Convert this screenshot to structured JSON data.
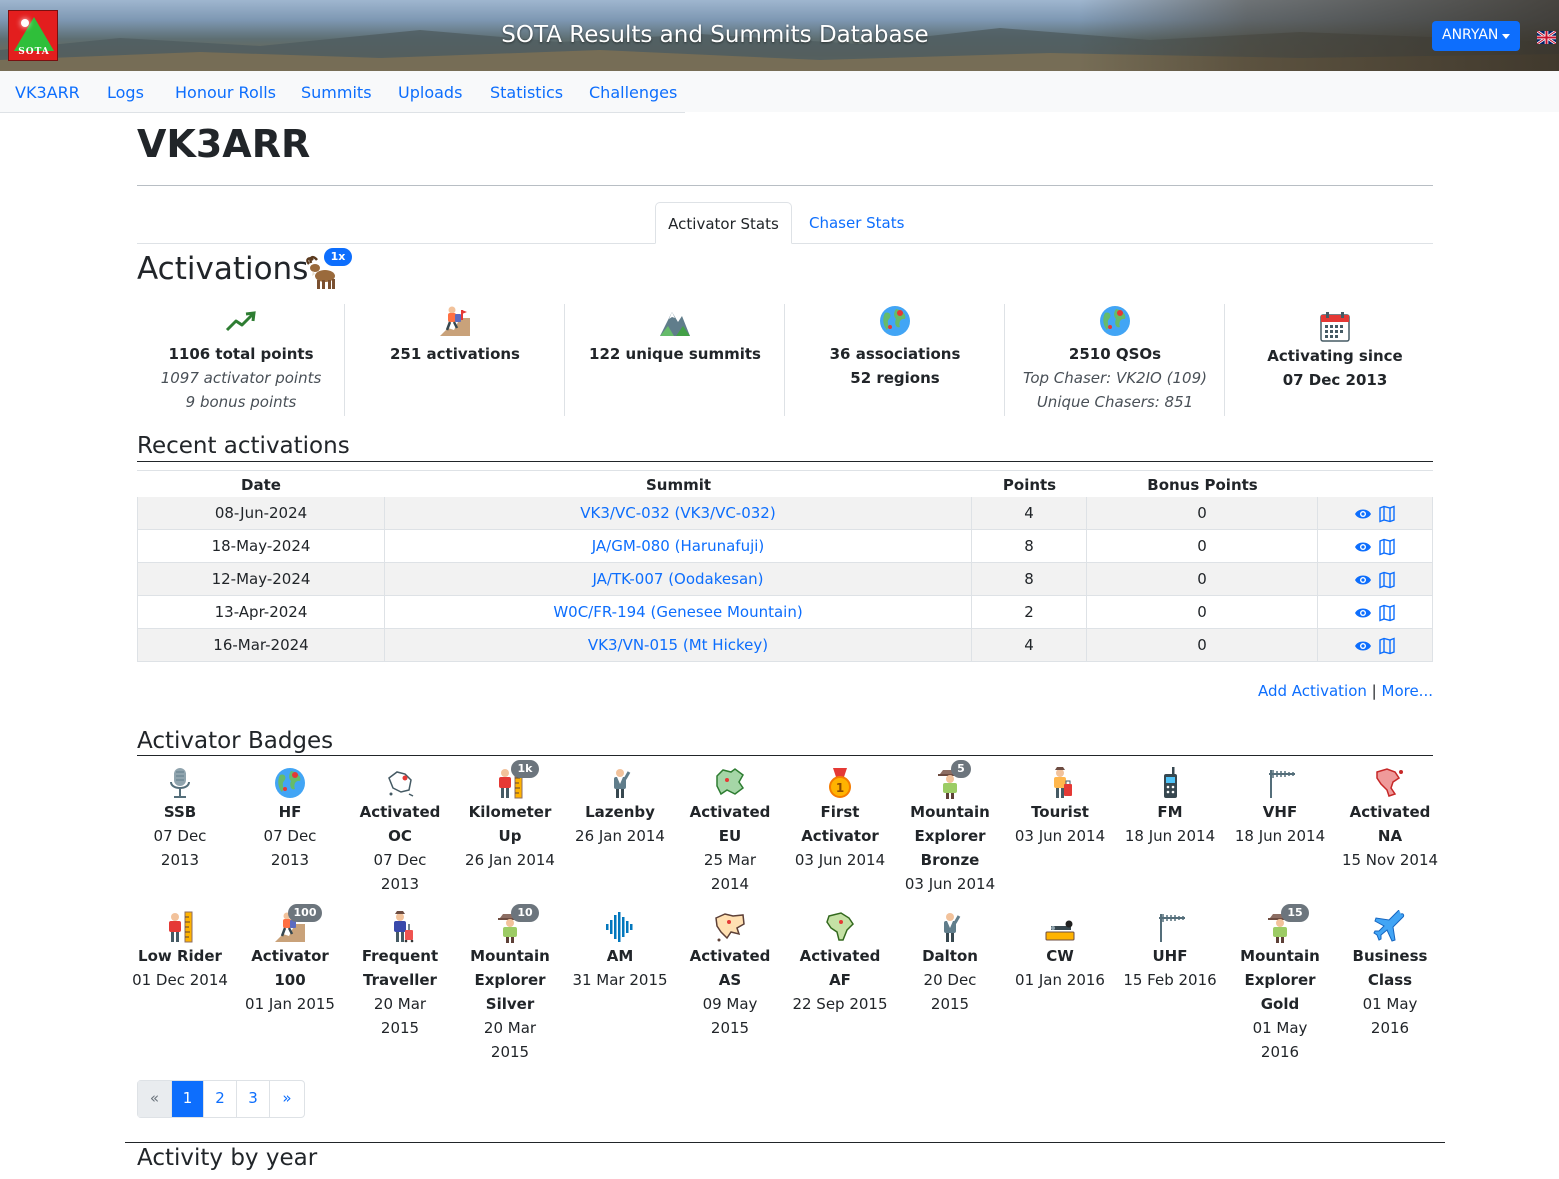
{
  "header": {
    "site_title": "SOTA Results and Summits Database",
    "logo_text": "SOTA",
    "user_button": "ANRYAN"
  },
  "nav": [
    "VK3ARR",
    "Logs",
    "Honour Rolls",
    "Summits",
    "Uploads",
    "Statistics",
    "Challenges"
  ],
  "page_title": "VK3ARR",
  "tabs": {
    "active": "Activator Stats",
    "other": "Chaser Stats"
  },
  "activations": {
    "heading": "Activations",
    "goat_badge": "1x",
    "stats": [
      {
        "icon": "trending-up-icon",
        "lines": [
          "1106 total points"
        ],
        "italics": [
          "1097 activator points",
          "9 bonus points"
        ]
      },
      {
        "icon": "climber-icon",
        "lines": [
          "251 activations"
        ],
        "italics": []
      },
      {
        "icon": "mountain-icon",
        "lines": [
          "122 unique summits"
        ],
        "italics": []
      },
      {
        "icon": "globe-icon",
        "lines": [
          "36 associations",
          "52 regions"
        ],
        "italics": []
      },
      {
        "icon": "globe-icon",
        "lines": [
          "2510 QSOs"
        ],
        "italics": [
          "Top Chaser: VK2IO (109)",
          "Unique Chasers: 851"
        ]
      },
      {
        "icon": "calendar-icon",
        "lines": [
          "Activating since",
          "07 Dec 2013"
        ],
        "italics": []
      }
    ]
  },
  "recent": {
    "heading": "Recent activations",
    "columns": [
      "Date",
      "Summit",
      "Points",
      "Bonus Points"
    ],
    "rows": [
      {
        "date": "08-Jun-2024",
        "summit": "VK3/VC-032 (VK3/VC-032)",
        "points": "4",
        "bonus": "0"
      },
      {
        "date": "18-May-2024",
        "summit": "JA/GM-080 (Harunafuji)",
        "points": "8",
        "bonus": "0"
      },
      {
        "date": "12-May-2024",
        "summit": "JA/TK-007 (Oodakesan)",
        "points": "8",
        "bonus": "0"
      },
      {
        "date": "13-Apr-2024",
        "summit": "W0C/FR-194 (Genesee Mountain)",
        "points": "2",
        "bonus": "0"
      },
      {
        "date": "16-Mar-2024",
        "summit": "VK3/VN-015 (Mt Hickey)",
        "points": "4",
        "bonus": "0"
      }
    ],
    "add_link": "Add Activation",
    "separator": "|",
    "more_link": "More..."
  },
  "badges": {
    "heading": "Activator Badges",
    "items": [
      {
        "icon": "microphone-icon",
        "name": [
          "SSB"
        ],
        "date": [
          "07 Dec",
          "2013"
        ],
        "count": ""
      },
      {
        "icon": "globe-icon",
        "name": [
          "HF"
        ],
        "date": [
          "07 Dec",
          "2013"
        ],
        "count": ""
      },
      {
        "icon": "oceania-map-icon",
        "name": [
          "Activated",
          "OC"
        ],
        "date": [
          "07 Dec",
          "2013"
        ],
        "count": ""
      },
      {
        "icon": "measuring-man-icon",
        "name": [
          "Kilometer",
          "Up"
        ],
        "date": [
          "26 Jan 2014"
        ],
        "count": "1k"
      },
      {
        "icon": "man-icon",
        "name": [
          "Lazenby"
        ],
        "date": [
          "26 Jan 2014"
        ],
        "count": ""
      },
      {
        "icon": "europe-map-icon",
        "name": [
          "Activated",
          "EU"
        ],
        "date": [
          "25 Mar",
          "2014"
        ],
        "count": ""
      },
      {
        "icon": "medal-icon",
        "name": [
          "First",
          "Activator"
        ],
        "date": [
          "03 Jun 2014"
        ],
        "count": ""
      },
      {
        "icon": "explorer-icon",
        "name": [
          "Mountain",
          "Explorer",
          "Bronze"
        ],
        "date": [
          "03 Jun 2014"
        ],
        "count": "5"
      },
      {
        "icon": "tourist-icon",
        "name": [
          "Tourist"
        ],
        "date": [
          "03 Jun 2014"
        ],
        "count": ""
      },
      {
        "icon": "radio-icon",
        "name": [
          "FM"
        ],
        "date": [
          "18 Jun 2014"
        ],
        "count": ""
      },
      {
        "icon": "antenna-icon",
        "name": [
          "VHF"
        ],
        "date": [
          "18 Jun 2014"
        ],
        "count": ""
      },
      {
        "icon": "north-america-map-icon",
        "name": [
          "Activated",
          "NA"
        ],
        "date": [
          "15 Nov 2014"
        ],
        "count": ""
      },
      {
        "icon": "measuring-man-icon",
        "name": [
          "Low Rider"
        ],
        "date": [
          "01 Dec 2014"
        ],
        "count": ""
      },
      {
        "icon": "climber-icon",
        "name": [
          "Activator",
          "100"
        ],
        "date": [
          "01 Jan 2015"
        ],
        "count": "100"
      },
      {
        "icon": "traveller-icon",
        "name": [
          "Frequent",
          "Traveller"
        ],
        "date": [
          "20 Mar",
          "2015"
        ],
        "count": ""
      },
      {
        "icon": "explorer-icon",
        "name": [
          "Mountain",
          "Explorer",
          "Silver"
        ],
        "date": [
          "20 Mar",
          "2015"
        ],
        "count": "10"
      },
      {
        "icon": "soundwave-icon",
        "name": [
          "AM"
        ],
        "date": [
          "31 Mar 2015"
        ],
        "count": ""
      },
      {
        "icon": "asia-map-icon",
        "name": [
          "Activated",
          "AS"
        ],
        "date": [
          "09 May",
          "2015"
        ],
        "count": ""
      },
      {
        "icon": "africa-map-icon",
        "name": [
          "Activated",
          "AF"
        ],
        "date": [
          "22 Sep 2015"
        ],
        "count": ""
      },
      {
        "icon": "man-icon",
        "name": [
          "Dalton"
        ],
        "date": [
          "20 Dec",
          "2015"
        ],
        "count": ""
      },
      {
        "icon": "morse-key-icon",
        "name": [
          "CW"
        ],
        "date": [
          "01 Jan 2016"
        ],
        "count": ""
      },
      {
        "icon": "antenna-icon",
        "name": [
          "UHF"
        ],
        "date": [
          "15 Feb 2016"
        ],
        "count": ""
      },
      {
        "icon": "explorer-icon",
        "name": [
          "Mountain",
          "Explorer",
          "Gold"
        ],
        "date": [
          "01 May",
          "2016"
        ],
        "count": "15"
      },
      {
        "icon": "airplane-icon",
        "name": [
          "Business",
          "Class"
        ],
        "date": [
          "01 May",
          "2016"
        ],
        "count": ""
      }
    ]
  },
  "pager": [
    "«",
    "1",
    "2",
    "3",
    "»"
  ],
  "activity_heading": "Activity by year",
  "colors": {
    "accent": "#0d6efd",
    "badge_gray": "#6c757d"
  }
}
